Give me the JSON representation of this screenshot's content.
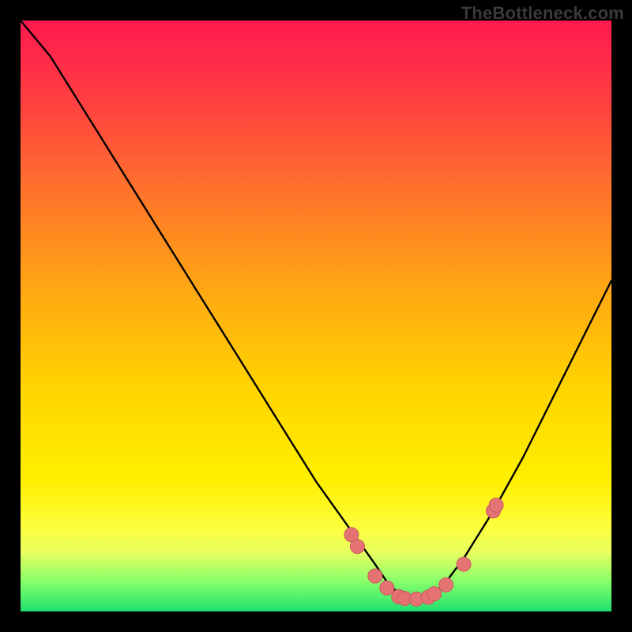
{
  "watermark": "TheBottleneck.com",
  "colors": {
    "background": "#000000",
    "curve": "#000000",
    "marker_fill": "#e57373",
    "marker_stroke": "#c95a5a"
  },
  "chart_data": {
    "type": "line",
    "title": "",
    "xlabel": "",
    "ylabel": "",
    "xlim": [
      0,
      100
    ],
    "ylim": [
      0,
      100
    ],
    "series": [
      {
        "name": "bottleneck-curve",
        "x": [
          0,
          5,
          10,
          15,
          20,
          25,
          30,
          35,
          40,
          45,
          50,
          55,
          60,
          62,
          64,
          66,
          68,
          70,
          72,
          75,
          80,
          85,
          90,
          95,
          100
        ],
        "y": [
          100,
          94,
          86,
          78,
          70,
          62,
          54,
          46,
          38,
          30,
          22,
          15,
          8,
          5,
          3,
          2,
          2,
          3,
          5,
          9,
          17,
          26,
          36,
          46,
          56
        ]
      }
    ],
    "markers": {
      "name": "bottleneck-markers",
      "x": [
        56,
        57,
        60,
        62,
        64,
        65,
        67,
        69,
        70,
        72,
        75,
        80,
        80.5
      ],
      "y": [
        13,
        11,
        6,
        4,
        2.5,
        2.2,
        2.1,
        2.4,
        3,
        4.5,
        8,
        17,
        18
      ]
    }
  }
}
